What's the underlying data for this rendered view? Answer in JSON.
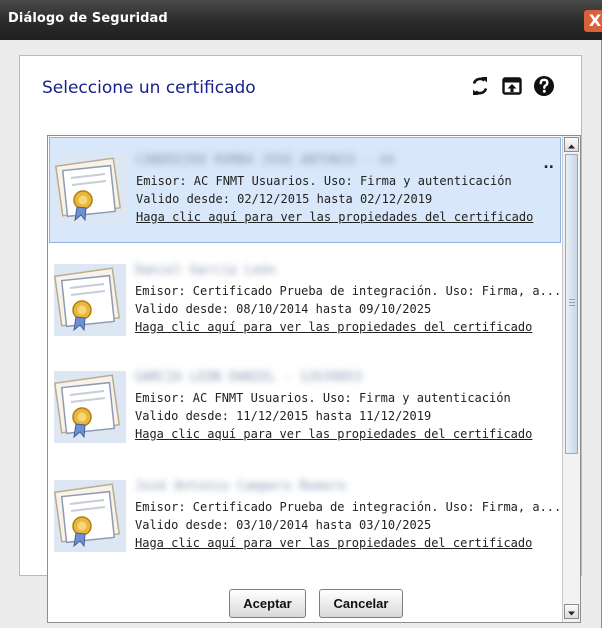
{
  "window": {
    "title": "Diálogo de Seguridad",
    "close_glyph": "X"
  },
  "dialog": {
    "heading": "Seleccione un certificado",
    "toolbar": [
      {
        "name": "refresh-icon"
      },
      {
        "name": "open-file-icon"
      },
      {
        "name": "help-icon"
      }
    ]
  },
  "certificates": [
    {
      "name": "CANDEEIRO ROMBA JOSE ANTONIO - 44",
      "issuer_line": "Emisor: AC FNMT Usuarios. Uso: Firma y autenticación",
      "validity_line": "Valido desde: 02/12/2015 hasta 02/12/2019",
      "link": "Haga clic aquí para ver las propiedades del certificado",
      "selected": true
    },
    {
      "name": "Daniel García León",
      "issuer_line": "Emisor: Certificado Prueba de integración. Uso: Firma, a...",
      "validity_line": "Valido desde: 08/10/2014 hasta 09/10/2025",
      "link": "Haga clic aquí para ver las propiedades del certificado",
      "selected": false
    },
    {
      "name": "GARCIA LEON DANIEL - 12639853",
      "issuer_line": "Emisor: AC FNMT Usuarios. Uso: Firma y autenticación",
      "validity_line": "Valido desde: 11/12/2015 hasta 11/12/2019",
      "link": "Haga clic aquí para ver las propiedades del certificado",
      "selected": false
    },
    {
      "name": "José Antonio Campero Romero",
      "issuer_line": "Emisor: Certificado Prueba de integración. Uso: Firma, a...",
      "validity_line": "Valido desde: 03/10/2014 hasta 03/10/2025",
      "link": "Haga clic aquí para ver las propiedades del certificado",
      "selected": false
    }
  ],
  "buttons": {
    "accept": "Aceptar",
    "cancel": "Cancelar"
  },
  "colors": {
    "heading": "#19208a",
    "selection": "#d8e7fa",
    "titlebar": "#2b2b2b"
  }
}
